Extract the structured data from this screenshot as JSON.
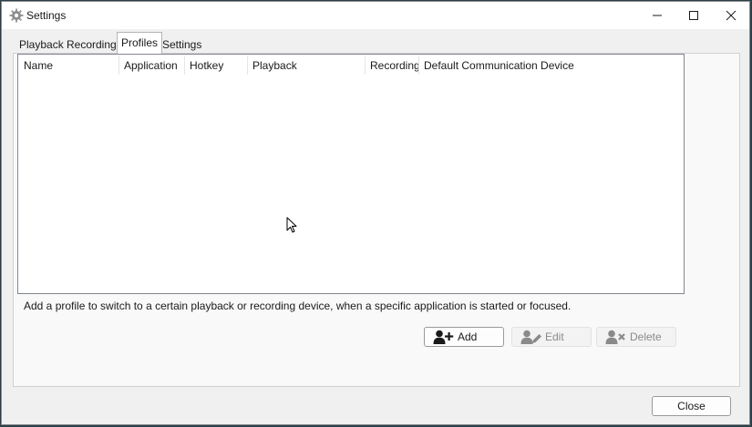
{
  "window": {
    "title": "Settings"
  },
  "tabs": [
    {
      "label": "Playback",
      "active": false
    },
    {
      "label": "Recording",
      "active": false
    },
    {
      "label": "Profiles",
      "active": true
    },
    {
      "label": "Settings",
      "active": false
    }
  ],
  "profiles_table": {
    "columns": [
      "Name",
      "Application",
      "Hotkey",
      "Playback",
      "Recording",
      "Default Communication Device"
    ],
    "rows": []
  },
  "hint_text": "Add a profile to switch to a certain playback or recording device, when a specific application is started or focused.",
  "buttons": {
    "add": "Add",
    "edit": "Edit",
    "delete": "Delete",
    "close": "Close"
  },
  "colors": {
    "window_bg": "#f0f0f0",
    "disabled_text": "#8a8a8a",
    "desktop_bg": "#2a3f4a"
  },
  "icons": {
    "app": "gear-icon",
    "add": "add-user-icon",
    "edit": "edit-user-icon",
    "delete": "delete-user-icon"
  }
}
